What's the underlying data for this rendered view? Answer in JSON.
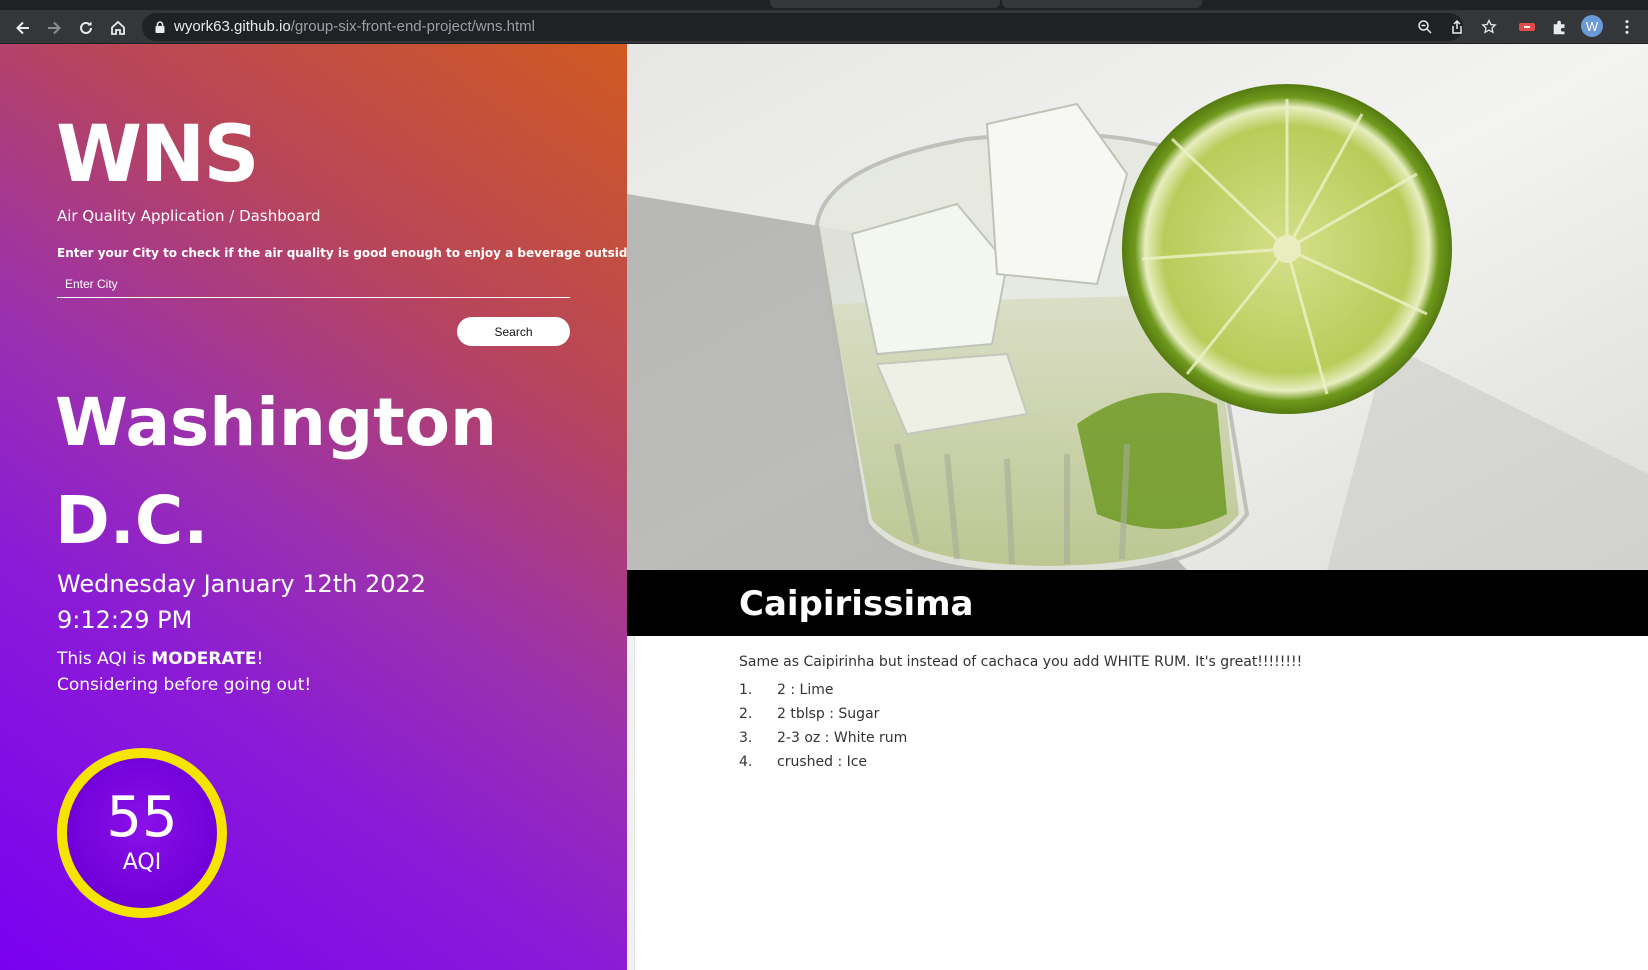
{
  "browser": {
    "url_host": "wyork63.github.io",
    "url_path": "/group-six-front-end-project/wns.html",
    "profile_initial": "W",
    "icons": [
      "back-icon",
      "forward-icon",
      "reload-icon",
      "home-icon",
      "lock-icon",
      "zoom-icon",
      "share-icon",
      "bookmark-star-icon",
      "extension-icon",
      "puzzle-icon",
      "menu-icon"
    ]
  },
  "app": {
    "brand": "WNS",
    "subtitle": "Air Quality Application / Dashboard",
    "prompt": "Enter your City to check if the air quality is good enough to enjoy a beverage outside!",
    "city_placeholder": "Enter City",
    "search_label": "Search"
  },
  "weather": {
    "city": "Washington D.C.",
    "date": "Wednesday January 12th 2022",
    "time": "9:12:29 PM",
    "aqi_prefix": "This AQI is ",
    "aqi_level": "MODERATE",
    "aqi_suffix": "!",
    "advice": "Considering before going out!",
    "aqi_value": "55",
    "aqi_label": "AQI",
    "gauge_color": "#f5e400"
  },
  "drink": {
    "name": "Caipirissima",
    "description": "Same as Caipirinha but instead of cachaca you add WHITE RUM. It's great!!!!!!!!",
    "ingredients": [
      {
        "num": "1.",
        "text": "2 : Lime"
      },
      {
        "num": "2.",
        "text": "2 tblsp : Sugar"
      },
      {
        "num": "3.",
        "text": "2-3 oz : White rum"
      },
      {
        "num": "4.",
        "text": "crushed : Ice"
      }
    ]
  },
  "colors": {
    "panel_gradient_start": "#7a00f0",
    "panel_gradient_end": "#d05a20",
    "banner": "#000000"
  }
}
